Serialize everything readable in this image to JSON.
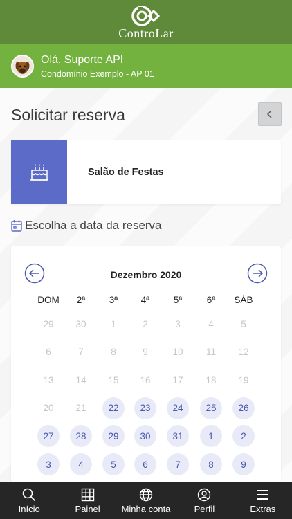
{
  "header": {
    "logo_text": "ControLar",
    "brand_color": "#5e8a3a"
  },
  "user": {
    "greeting": "Olá, Suporte API",
    "condo": "Condomínio Exemplo - AP 01",
    "bar_color": "#74b240"
  },
  "page": {
    "title": "Solicitar reserva",
    "back_icon": "chevron-left-icon"
  },
  "venue": {
    "name": "Salão de Festas",
    "icon": "birthday-cake-icon",
    "icon_bg": "#5c6bc8"
  },
  "date_section": {
    "label": "Escolha a data da reserva",
    "icon": "calendar-icon"
  },
  "calendar": {
    "month": "Dezembro 2020",
    "weekdays": [
      "DOM",
      "2ª",
      "3ª",
      "4ª",
      "5ª",
      "6ª",
      "SÁB"
    ],
    "weeks": [
      [
        {
          "d": "29",
          "on": false
        },
        {
          "d": "30",
          "on": false
        },
        {
          "d": "1",
          "on": false
        },
        {
          "d": "2",
          "on": false
        },
        {
          "d": "3",
          "on": false
        },
        {
          "d": "4",
          "on": false
        },
        {
          "d": "5",
          "on": false
        }
      ],
      [
        {
          "d": "6",
          "on": false
        },
        {
          "d": "7",
          "on": false
        },
        {
          "d": "8",
          "on": false
        },
        {
          "d": "9",
          "on": false
        },
        {
          "d": "10",
          "on": false
        },
        {
          "d": "11",
          "on": false
        },
        {
          "d": "12",
          "on": false
        }
      ],
      [
        {
          "d": "13",
          "on": false
        },
        {
          "d": "14",
          "on": false
        },
        {
          "d": "15",
          "on": false
        },
        {
          "d": "16",
          "on": false
        },
        {
          "d": "17",
          "on": false
        },
        {
          "d": "18",
          "on": false
        },
        {
          "d": "19",
          "on": false
        }
      ],
      [
        {
          "d": "20",
          "on": false
        },
        {
          "d": "21",
          "on": false
        },
        {
          "d": "22",
          "on": true
        },
        {
          "d": "23",
          "on": true
        },
        {
          "d": "24",
          "on": true
        },
        {
          "d": "25",
          "on": true
        },
        {
          "d": "26",
          "on": true
        }
      ],
      [
        {
          "d": "27",
          "on": true
        },
        {
          "d": "28",
          "on": true
        },
        {
          "d": "29",
          "on": true
        },
        {
          "d": "30",
          "on": true
        },
        {
          "d": "31",
          "on": true
        },
        {
          "d": "1",
          "on": true
        },
        {
          "d": "2",
          "on": true
        }
      ],
      [
        {
          "d": "3",
          "on": true
        },
        {
          "d": "4",
          "on": true
        },
        {
          "d": "5",
          "on": true
        },
        {
          "d": "6",
          "on": true
        },
        {
          "d": "7",
          "on": true
        },
        {
          "d": "8",
          "on": true
        },
        {
          "d": "9",
          "on": true
        }
      ]
    ],
    "accent": "#4c58b0"
  },
  "nav": {
    "items": [
      {
        "label": "Início",
        "icon": "search-icon"
      },
      {
        "label": "Painel",
        "icon": "grid-icon"
      },
      {
        "label": "Minha conta",
        "icon": "globe-icon"
      },
      {
        "label": "Perfil",
        "icon": "user-icon"
      },
      {
        "label": "Extras",
        "icon": "menu-icon"
      }
    ]
  }
}
